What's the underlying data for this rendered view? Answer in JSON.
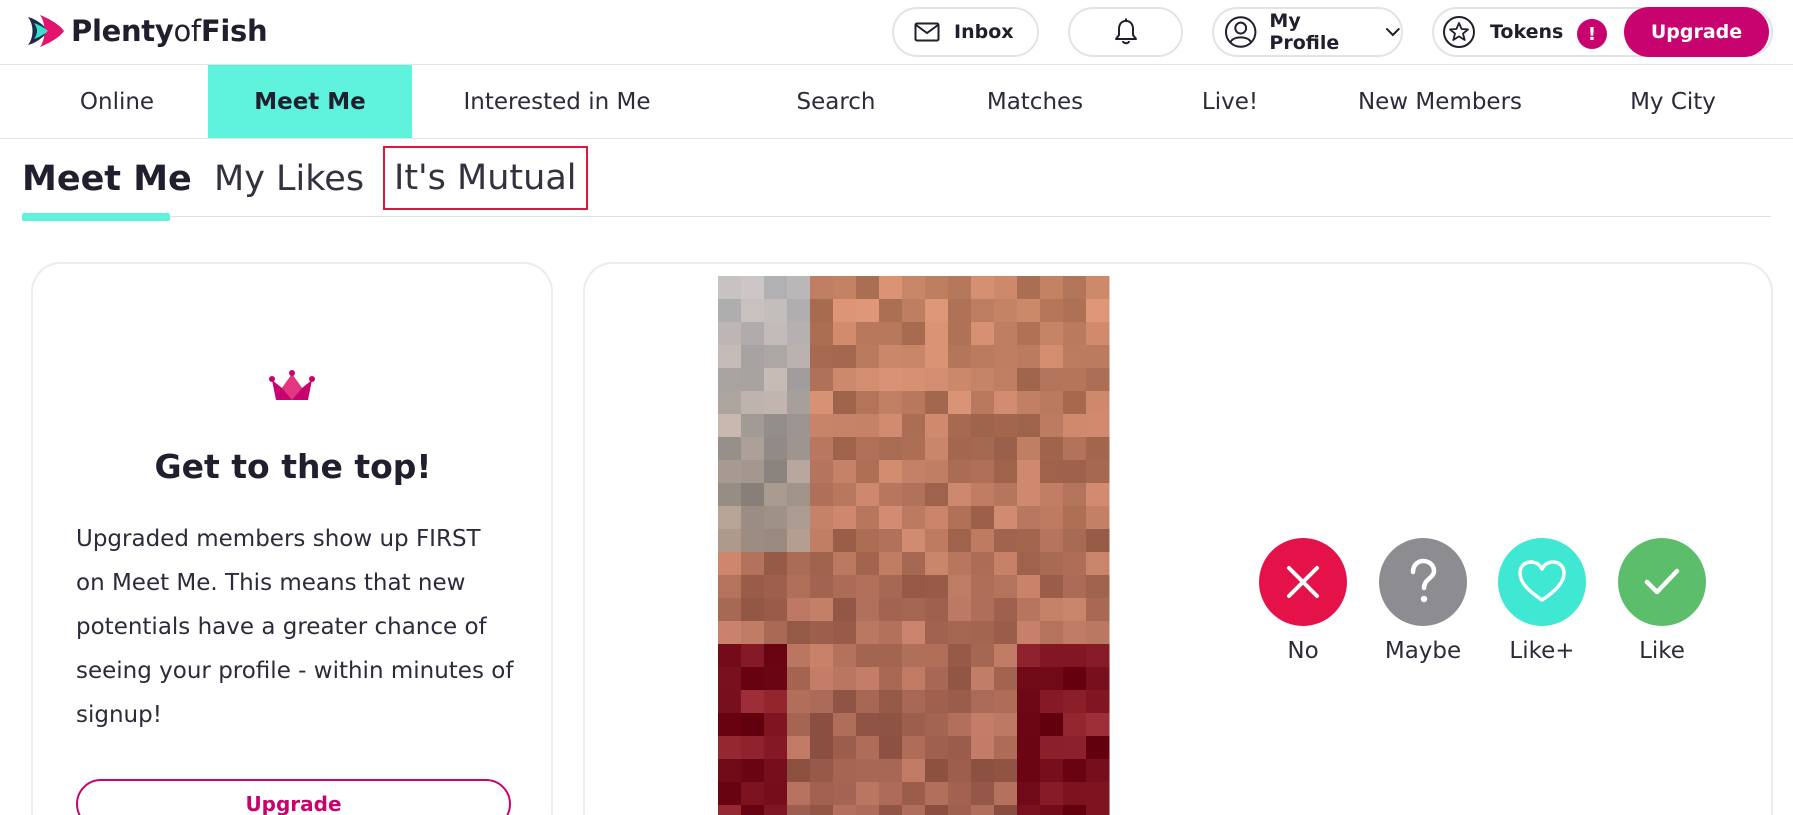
{
  "header": {
    "logo": {
      "word1": "Plenty",
      "word2": "of",
      "word3": "Fish"
    },
    "inbox_label": "Inbox",
    "profile_label": "My Profile",
    "tokens_label": "Tokens",
    "tokens_badge": "!",
    "upgrade_label": "Upgrade"
  },
  "nav": {
    "items": [
      {
        "label": "Online"
      },
      {
        "label": "Meet Me",
        "active": true
      },
      {
        "label": "Interested in Me"
      },
      {
        "label": "Search"
      },
      {
        "label": "Matches"
      },
      {
        "label": "Live!"
      },
      {
        "label": "New Members"
      },
      {
        "label": "My City"
      }
    ]
  },
  "subtabs": {
    "items": [
      {
        "label": "Meet Me",
        "active": true
      },
      {
        "label": "My Likes"
      },
      {
        "label": "It's Mutual",
        "highlighted": true
      }
    ]
  },
  "promo": {
    "icon": "crown-icon",
    "title": "Get to the top!",
    "body": "Upgraded members show up FIRST on Meet Me. This means that new potentials have a greater chance of seeing your profile - within minutes of signup!",
    "button_label": "Upgrade"
  },
  "profile": {
    "photo": "pixelated-profile-photo",
    "actions": [
      {
        "label": "No",
        "icon": "x-icon",
        "color": "#e5124a"
      },
      {
        "label": "Maybe",
        "icon": "question-icon",
        "color": "#8c8c91"
      },
      {
        "label": "Like+",
        "icon": "heart-icon",
        "color": "#3ee8d2"
      },
      {
        "label": "Like",
        "icon": "check-icon",
        "color": "#5cbd6a"
      }
    ]
  },
  "colors": {
    "accent_teal": "#5ff2dc",
    "brand_magenta": "#c8036f",
    "highlight_red": "#e0163d"
  }
}
